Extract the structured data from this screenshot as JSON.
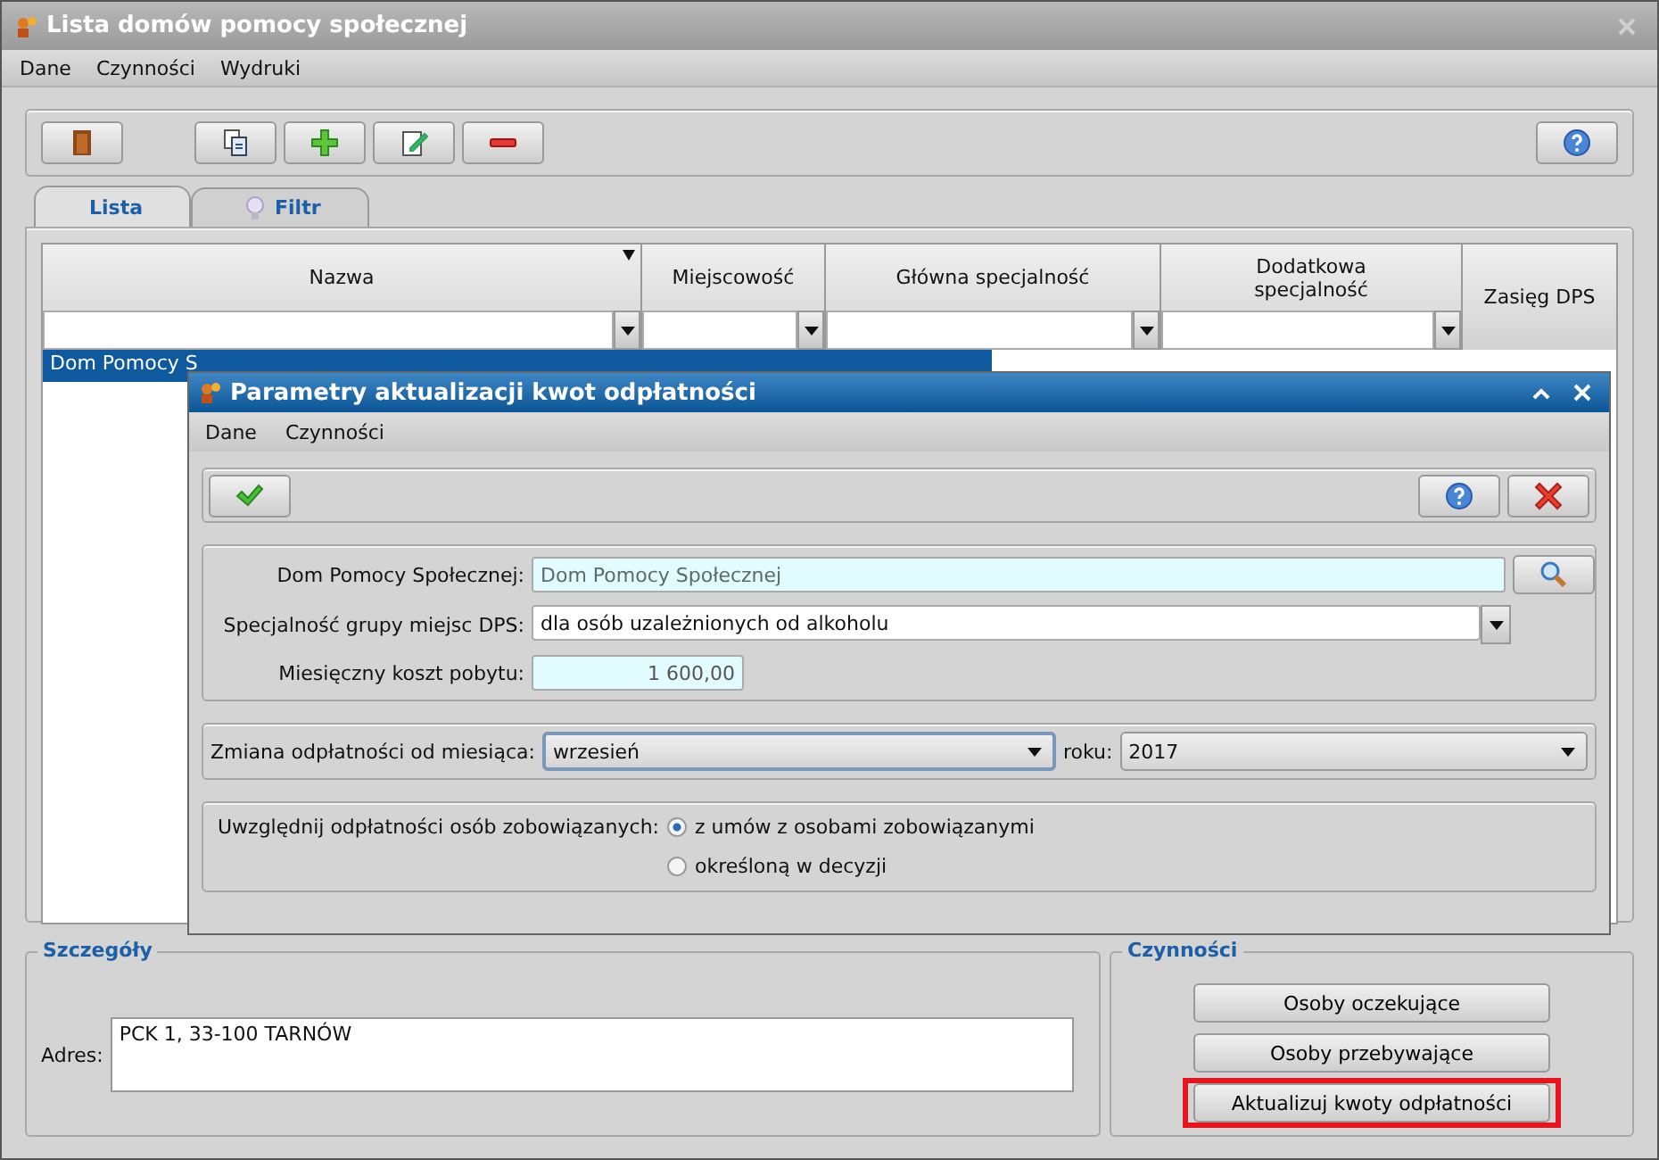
{
  "window": {
    "title": "Lista domów pomocy społecznej"
  },
  "menu": [
    "Dane",
    "Czynności",
    "Wydruki"
  ],
  "toolbar": [
    {
      "kind": "exit"
    },
    {
      "kind": "copy"
    },
    {
      "kind": "add"
    },
    {
      "kind": "edit"
    },
    {
      "kind": "remove"
    },
    {
      "kind": "help"
    }
  ],
  "tabs": [
    {
      "label": "Lista",
      "kind": "plain",
      "selected": true
    },
    {
      "label": "Filtr",
      "kind": "bulb",
      "selected": false
    }
  ],
  "table": {
    "columns": [
      {
        "label": "Nazwa",
        "sorted": true,
        "filter": true
      },
      {
        "label": "Miejscowość",
        "sorted": false,
        "filter": true
      },
      {
        "label": "Główna specjalność",
        "sorted": false,
        "filter": true
      },
      {
        "label": "Dodatkowa specjalność",
        "sorted": false,
        "filter": true
      },
      {
        "label": "Zasięg DPS",
        "sorted": false,
        "filter": false
      }
    ],
    "rows": [
      {
        "cells": [
          "Dom Pomocy S"
        ],
        "selected": true
      }
    ]
  },
  "details": {
    "title": "Szczegóły",
    "address_label": "Adres:",
    "address": "PCK 1, 33-100 TARNÓW"
  },
  "actions": {
    "title": "Czynności",
    "buttons": [
      {
        "label": "Osoby oczekujące",
        "highlighted": false
      },
      {
        "label": "Osoby przebywające",
        "highlighted": false
      },
      {
        "label": "Aktualizuj kwoty odpłatności",
        "highlighted": true
      }
    ]
  },
  "dialog": {
    "title": "Parametry aktualizacji kwot odpłatności",
    "menu": [
      "Dane",
      "Czynności"
    ],
    "toolbar": [
      {
        "kind": "ok"
      },
      {
        "kind": "help"
      },
      {
        "kind": "cancel"
      }
    ],
    "fields": [
      {
        "label": "Dom Pomocy Społecznej:",
        "kind": "lookup",
        "value": "Dom Pomocy Społecznej"
      },
      {
        "label": "Specjalność grupy miejsc DPS:",
        "kind": "select",
        "value": "dla osób uzależnionych od alkoholu"
      },
      {
        "label": "Miesięczny koszt pobytu:",
        "kind": "amount",
        "value": "1 600,00"
      }
    ],
    "period": {
      "label": "Zmiana odpłatności od miesiąca:",
      "month": "wrzesień",
      "year_label": "roku:",
      "year": "2017"
    },
    "obligations": {
      "label": "Uwzględnij odpłatności osób zobowiązanych:",
      "options": [
        {
          "label": "z umów z osobami zobowiązanymi",
          "selected": true
        },
        {
          "label": "określoną w decyzji",
          "selected": false
        }
      ]
    }
  }
}
